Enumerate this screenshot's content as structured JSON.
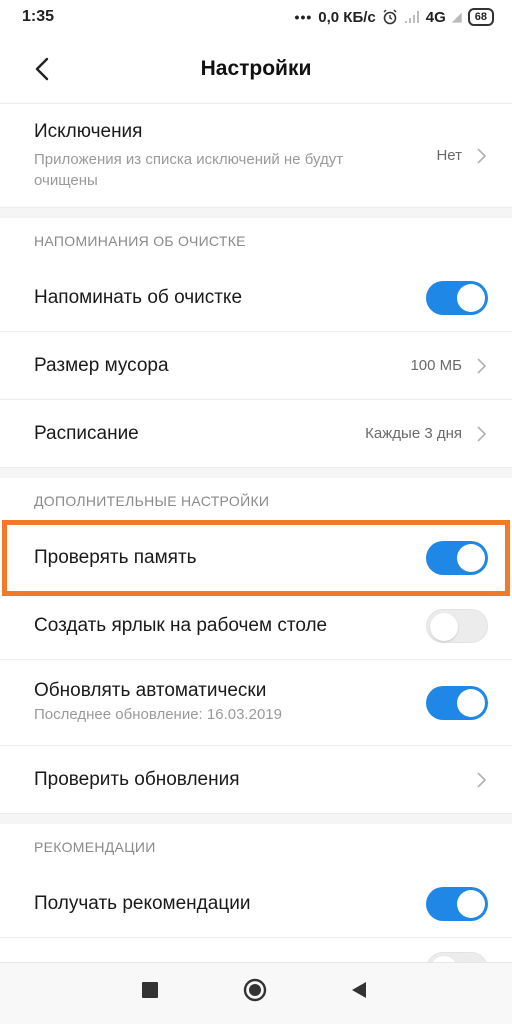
{
  "status": {
    "time": "1:35",
    "dots": "•••",
    "speed": "0,0 КБ/с",
    "network": "4G",
    "battery": "68"
  },
  "header": {
    "title": "Настройки",
    "back_icon": "chevron-left-icon"
  },
  "exclusions": {
    "label": "Исключения",
    "sub": "Приложения из списка исключений не будут очищены",
    "value": "Нет"
  },
  "sections": {
    "reminders": "НАПОМИНАНИЯ ОБ ОЧИСТКЕ",
    "additional": "ДОПОЛНИТЕЛЬНЫЕ НАСТРОЙКИ",
    "recommendations": "РЕКОМЕНДАЦИИ"
  },
  "reminders": {
    "remind_label": "Напоминать об очистке",
    "remind_on": true,
    "junk_label": "Размер мусора",
    "junk_value": "100 МБ",
    "schedule_label": "Расписание",
    "schedule_value": "Каждые 3 дня"
  },
  "additional": {
    "memory_label": "Проверять память",
    "memory_on": true,
    "shortcut_label": "Создать ярлык на рабочем столе",
    "shortcut_on": false,
    "autoupdate_label": "Обновлять автоматически",
    "autoupdate_sub": "Последнее обновление: 16.03.2019",
    "autoupdate_on": true,
    "check_updates_label": "Проверить обновления"
  },
  "recommendations": {
    "get_label": "Получать рекомендации",
    "get_on": true,
    "next_on": false
  },
  "colors": {
    "toggle_on": "#1f87e6",
    "highlight": "#f07a2a"
  },
  "navbar": {
    "recents_icon": "square-icon",
    "home_icon": "circle-icon",
    "back_icon": "triangle-back-icon"
  }
}
